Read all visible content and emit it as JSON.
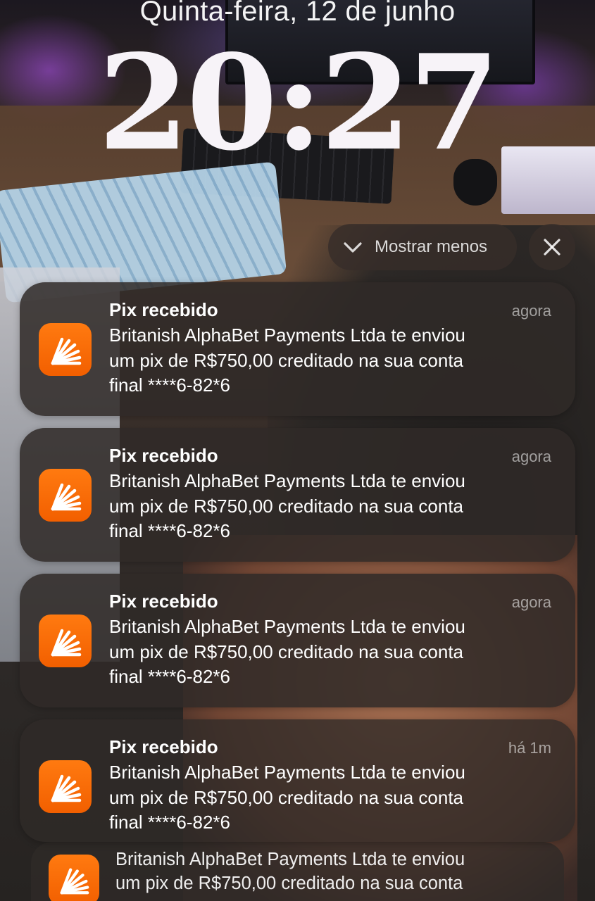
{
  "lock_screen": {
    "date": "Quinta-feira, 12 de junho",
    "time": "20:27"
  },
  "controls": {
    "show_less_label": "Mostrar menos",
    "show_less_icon": "chevron-down-icon",
    "close_icon": "close-icon"
  },
  "app": {
    "icon": "bank-app-icon",
    "accent_color": "#ff6a00"
  },
  "notifications": [
    {
      "title": "Pix recebido",
      "time": "agora",
      "body": "Britanish AlphaBet Payments Ltda te enviou\num pix de R$750,00 creditado na sua conta\nfinal ****6-82*6"
    },
    {
      "title": "Pix recebido",
      "time": "agora",
      "body": "Britanish AlphaBet Payments Ltda te enviou\num pix de R$750,00 creditado na sua conta\nfinal ****6-82*6"
    },
    {
      "title": "Pix recebido",
      "time": "agora",
      "body": "Britanish AlphaBet Payments Ltda te enviou\num pix de R$750,00 creditado na sua conta\nfinal ****6-82*6"
    },
    {
      "title": "Pix recebido",
      "time": "há 1m",
      "body": "Britanish AlphaBet Payments Ltda te enviou\num pix de R$750,00 creditado na sua conta\nfinal ****6-82*6"
    }
  ],
  "stacked_notification": {
    "body": "Britanish AlphaBet Payments Ltda te enviou\num pix de R$750,00 creditado na sua conta"
  }
}
